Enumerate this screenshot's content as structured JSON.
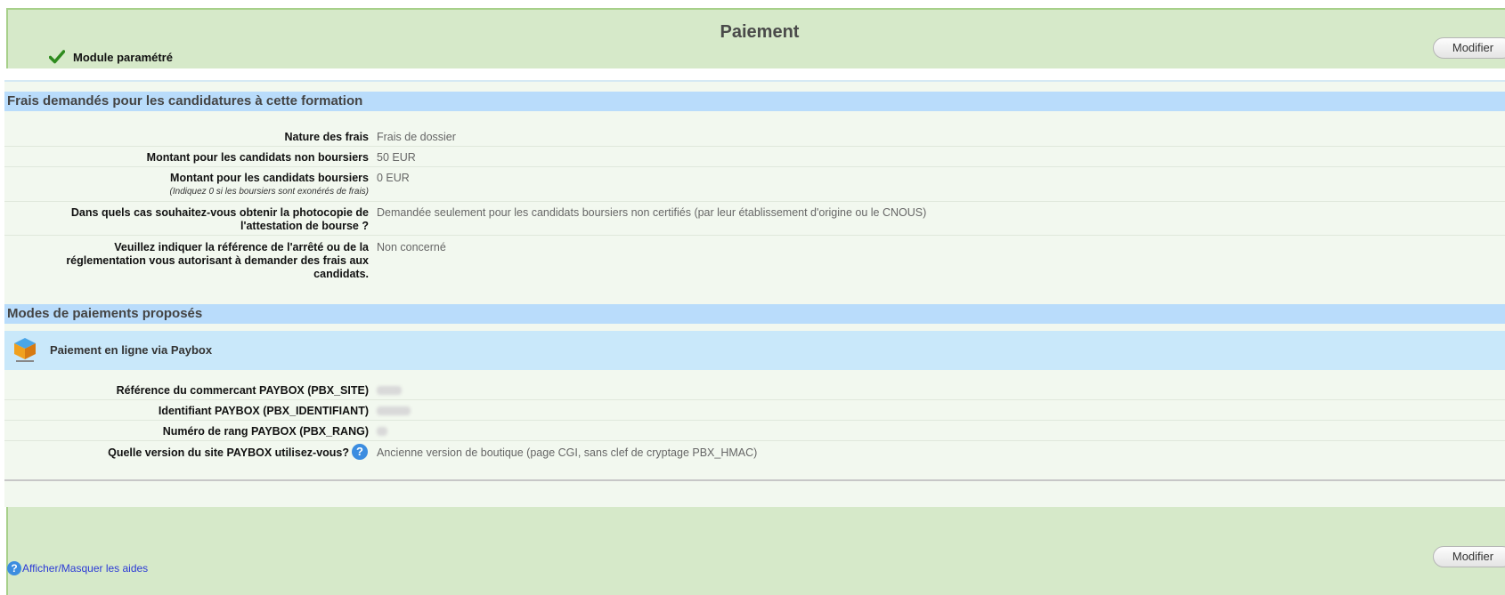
{
  "header": {
    "title": "Paiement",
    "status_label": "Module paramétré",
    "modify_label": "Modifier"
  },
  "fees": {
    "section_title": "Frais demandés pour les candidatures à cette formation",
    "rows": [
      {
        "label": "Nature des frais",
        "value": "Frais de dossier"
      },
      {
        "label": "Montant pour les candidats non boursiers",
        "value": "50 EUR"
      },
      {
        "label": "Montant pour les candidats boursiers",
        "hint": "(Indiquez 0 si les boursiers sont exonérés de frais)",
        "value": "0 EUR"
      },
      {
        "label_line1": "Dans quels cas souhaitez-vous obtenir la photocopie de",
        "label_line2": "l'attestation de bourse ?",
        "value": "Demandée seulement pour les candidats boursiers non certifiés (par leur établissement d'origine ou le CNOUS)"
      },
      {
        "label_line1": "Veuillez indiquer la référence de l'arrêté ou de la",
        "label_line2": "réglementation vous autorisant à demander des frais aux",
        "label_line3": "candidats.",
        "value": "Non concerné"
      }
    ]
  },
  "payment": {
    "section_title": "Modes de paiements proposés",
    "method_title": "Paiement en ligne via Paybox",
    "rows": [
      {
        "label": "Référence du commercant PAYBOX (PBX_SITE)"
      },
      {
        "label": "Identifiant PAYBOX (PBX_IDENTIFIANT)"
      },
      {
        "label": "Numéro de rang PAYBOX (PBX_RANG)"
      },
      {
        "label": "Quelle version du site PAYBOX utilisez-vous?",
        "value": "Ancienne version de boutique (page CGI, sans clef de cryptage PBX_HMAC)"
      }
    ],
    "help_glyph": "?"
  },
  "footer": {
    "toggle_help_label": "Afficher/Masquer les aides",
    "modify_label": "Modifier"
  },
  "colors": {
    "outer_bg": "#d6e9c9",
    "section_bg": "#b9dcfb",
    "method_bg": "#c9e8fa",
    "link": "#2b3ad6"
  }
}
